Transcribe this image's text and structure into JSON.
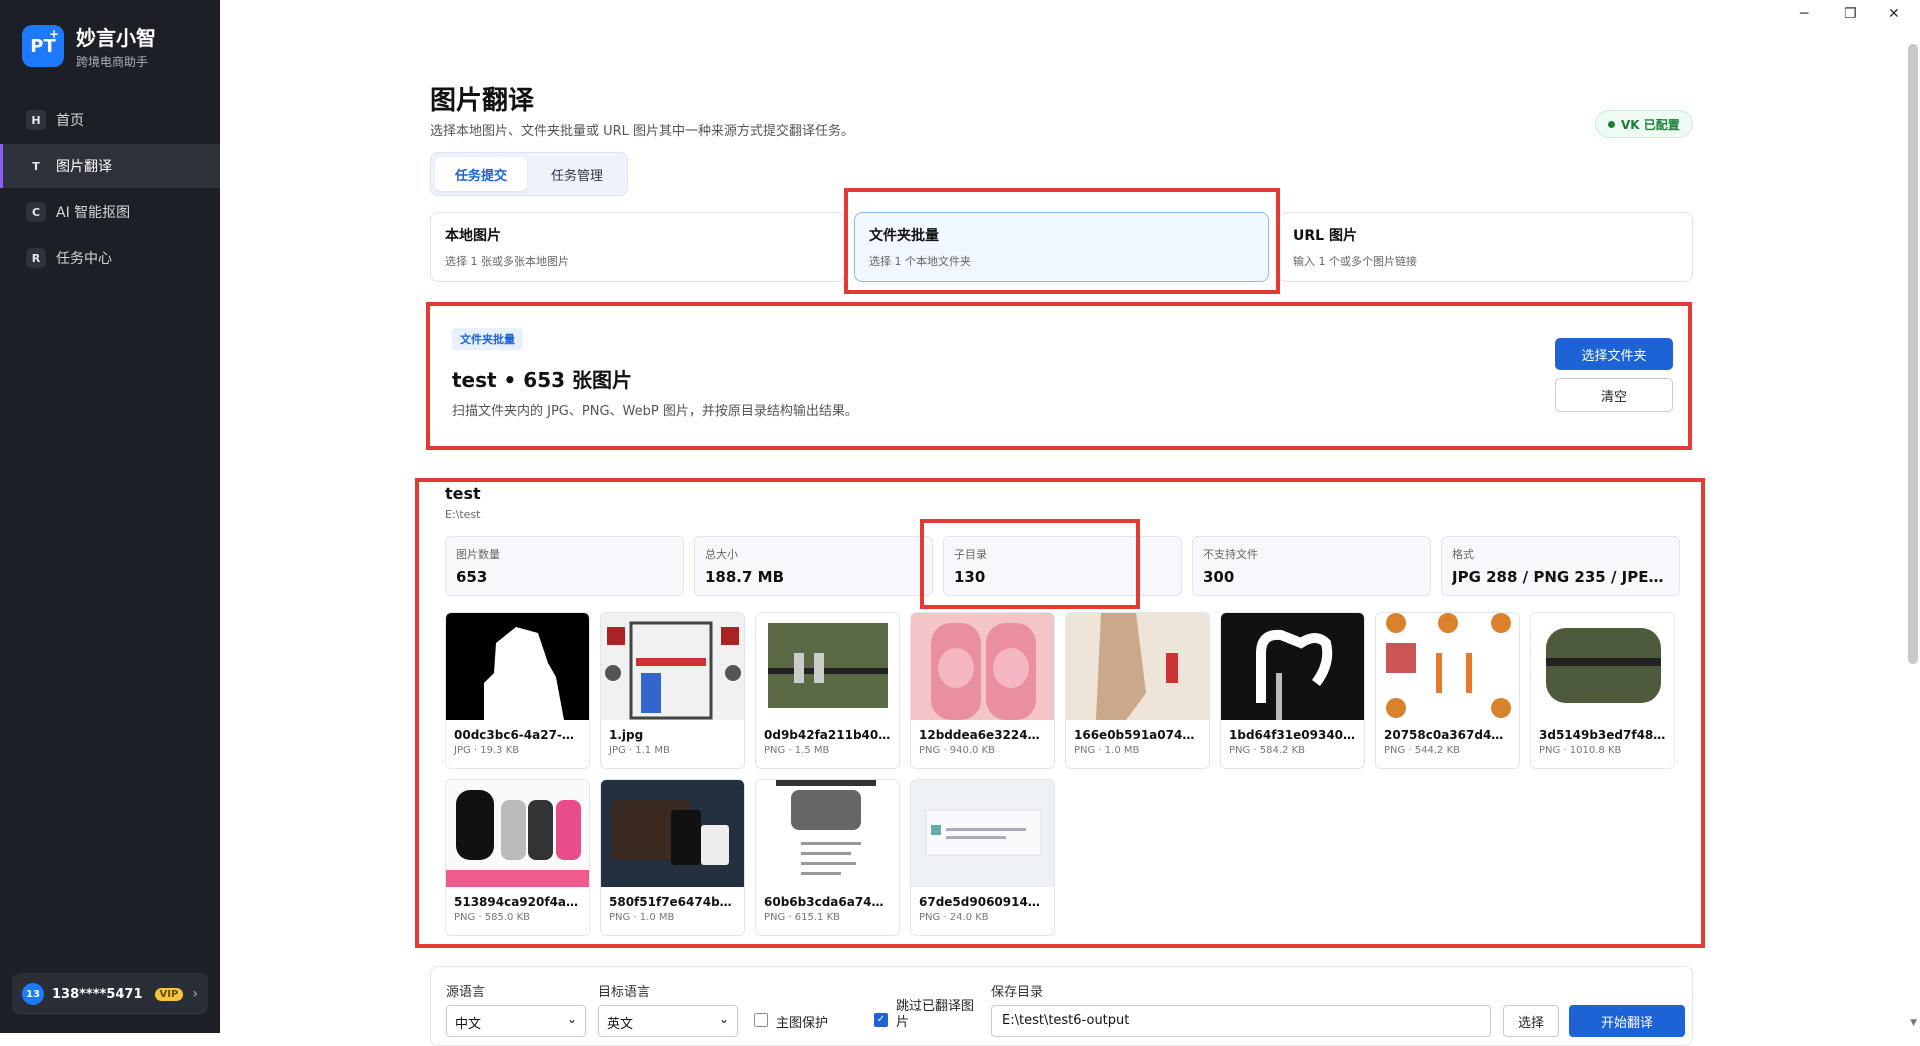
{
  "app": {
    "logo_text": "PT",
    "logo_plus": "+",
    "name": "妙言小智",
    "subtitle": "跨境电商助手"
  },
  "window": {
    "minimize": "─",
    "restore": "❐",
    "close": "✕"
  },
  "sidebar": {
    "items": [
      {
        "badge": "H",
        "label": "首页",
        "active": false
      },
      {
        "badge": "T",
        "label": "图片翻译",
        "active": true
      },
      {
        "badge": "C",
        "label": "AI 智能抠图",
        "active": false
      },
      {
        "badge": "R",
        "label": "任务中心",
        "active": false
      }
    ],
    "user": {
      "avatar": "13",
      "phone": "138****5471",
      "vip": "VIP",
      "chev": "›"
    }
  },
  "header": {
    "title": "图片翻译",
    "description": "选择本地图片、文件夹批量或 URL 图片其中一种来源方式提交翻译任务。",
    "vk_status": "VK 已配置"
  },
  "tabs": [
    {
      "label": "任务提交",
      "active": true
    },
    {
      "label": "任务管理",
      "active": false
    }
  ],
  "sources": [
    {
      "title": "本地图片",
      "sub": "选择 1 张或多张本地图片"
    },
    {
      "title": "文件夹批量",
      "sub": "选择 1 个本地文件夹"
    },
    {
      "title": "URL 图片",
      "sub": "输入 1 个或多个图片链接"
    }
  ],
  "folder": {
    "tag": "文件夹批量",
    "title": "test • 653 张图片",
    "desc": "扫描文件夹内的 JPG、PNG、WebP 图片，并按原目录结构输出结果。",
    "choose_button": "选择文件夹",
    "clear_button": "清空"
  },
  "preview": {
    "name": "test",
    "path": "E:\\test",
    "stats": [
      {
        "label": "图片数量",
        "value": "653"
      },
      {
        "label": "总大小",
        "value": "188.7 MB"
      },
      {
        "label": "子目录",
        "value": "130"
      },
      {
        "label": "不支持文件",
        "value": "300"
      },
      {
        "label": "格式",
        "value": "JPG 288 / PNG 235 / JPEG ..."
      }
    ],
    "files": [
      {
        "name": "00dc3bc6-4a27-4ff...",
        "meta": "JPG · 19.3 KB"
      },
      {
        "name": "1.jpg",
        "meta": "JPG · 1.1 MB"
      },
      {
        "name": "0d9b42fa211b400...",
        "meta": "PNG · 1.5 MB"
      },
      {
        "name": "12bddea6e3224ce...",
        "meta": "PNG · 940.0 KB"
      },
      {
        "name": "166e0b591a07449...",
        "meta": "PNG · 1.0 MB"
      },
      {
        "name": "1bd64f31e09340df...",
        "meta": "PNG · 584.2 KB"
      },
      {
        "name": "20758c0a367d463...",
        "meta": "PNG · 544.2 KB"
      },
      {
        "name": "3d5149b3ed7f48e...",
        "meta": "PNG · 1010.8 KB"
      },
      {
        "name": "513894ca920f4aaf...",
        "meta": "PNG · 585.0 KB"
      },
      {
        "name": "580f51f7e6474be3...",
        "meta": "PNG · 1.0 MB"
      },
      {
        "name": "60b6b3cda6a745fe...",
        "meta": "PNG · 615.1 KB"
      },
      {
        "name": "67de5d9060914e6...",
        "meta": "PNG · 24.0 KB"
      }
    ]
  },
  "bottom": {
    "source_lang_label": "源语言",
    "source_lang": "中文",
    "target_lang_label": "目标语言",
    "target_lang": "英文",
    "protect_label": "主图保护",
    "protect_checked": false,
    "skip_label": "跳过已翻译图片",
    "skip_checked": true,
    "save_dir_label": "保存目录",
    "save_dir": "E:\\test\\test6-output",
    "select_button": "选择",
    "start_button": "开始翻译"
  },
  "colors": {
    "accent": "#1d63d6",
    "sidebar_bg": "#1c1f25",
    "highlight": "#e53935",
    "status_ok": "#1a7f37"
  }
}
